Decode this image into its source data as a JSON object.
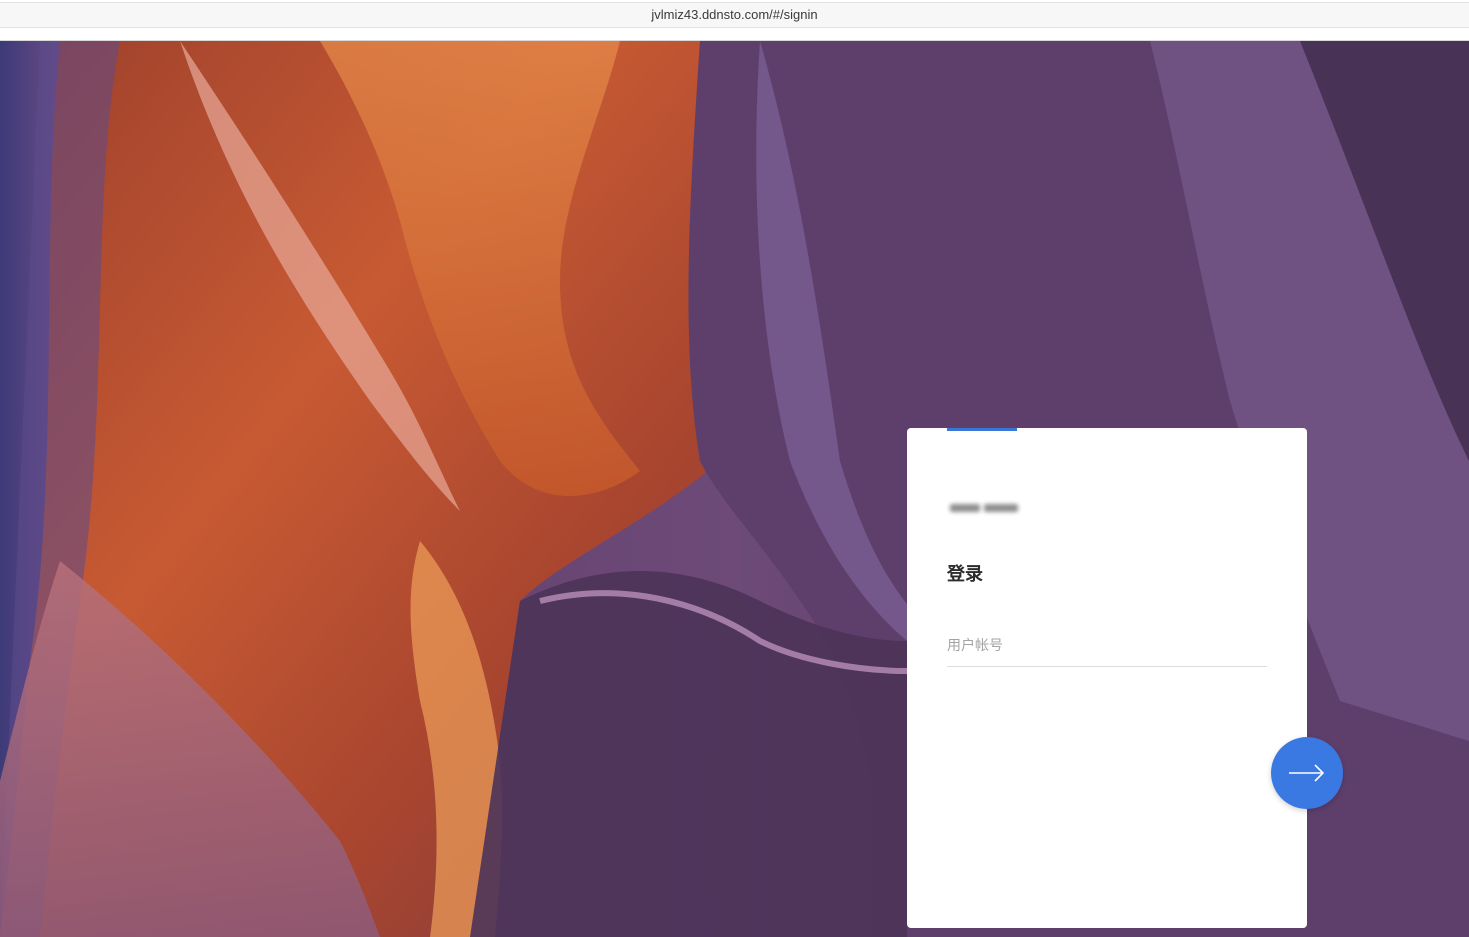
{
  "browser": {
    "url": "jvlmiz43.ddnsto.com/#/signin"
  },
  "login": {
    "title": "登录",
    "username_placeholder": "用户帐号",
    "submit_icon": "arrow-right-icon"
  },
  "colors": {
    "accent": "#3b76d9",
    "button": "#3a78e2",
    "card_background": "#ffffff"
  }
}
